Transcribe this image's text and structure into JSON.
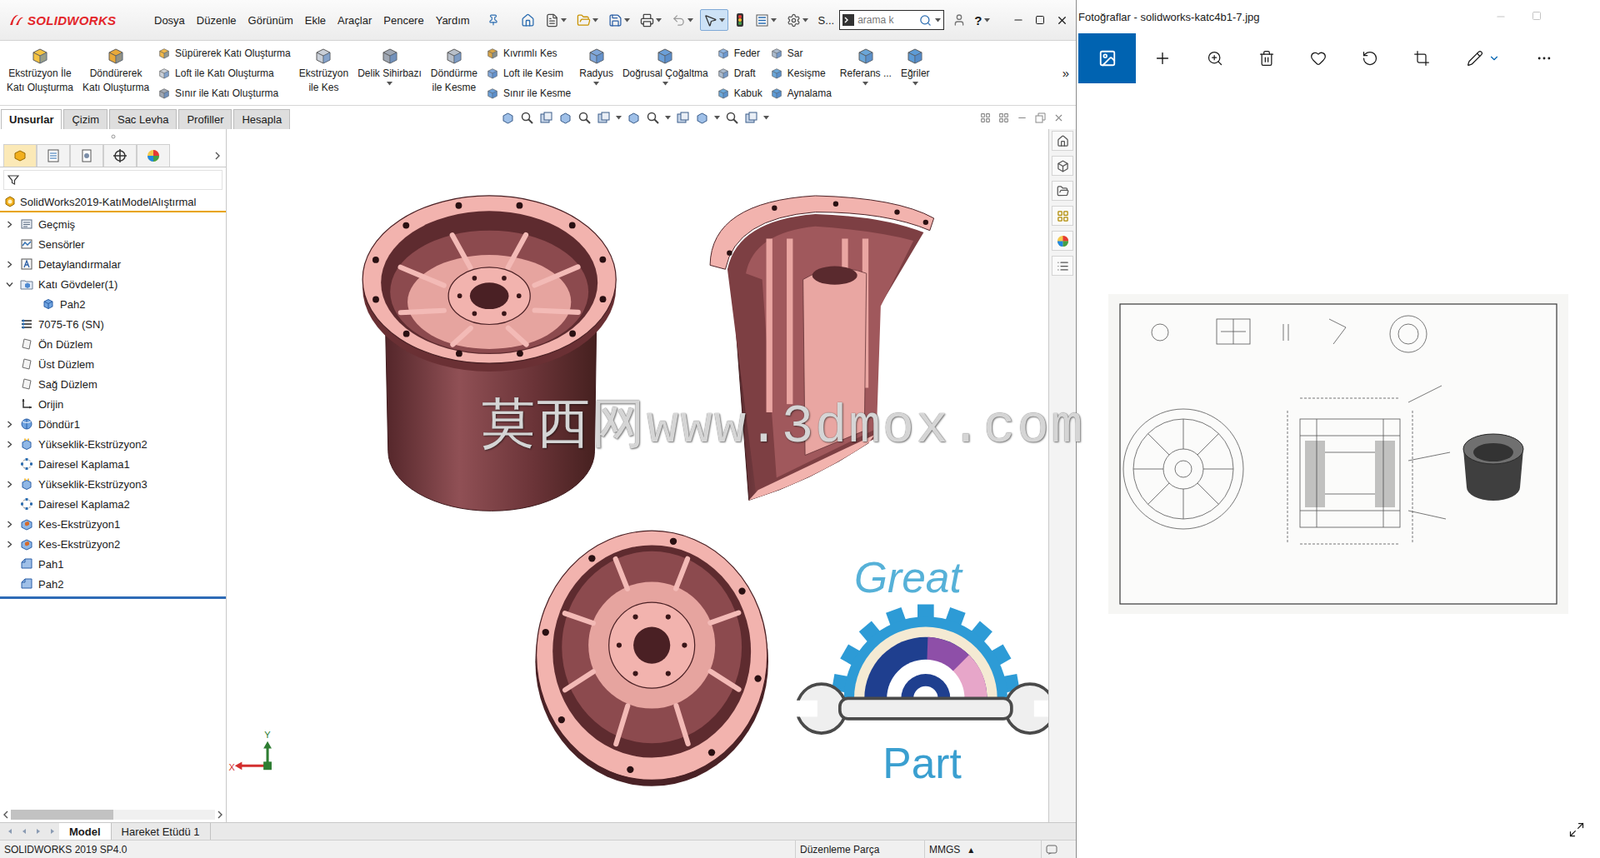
{
  "sw": {
    "logo": "SOLIDWORKS",
    "menus": [
      "Dosya",
      "Düzenle",
      "Görünüm",
      "Ekle",
      "Araçlar",
      "Pencere",
      "Yardım"
    ],
    "quick_tools": [
      {
        "kind": "home",
        "dropdown": false,
        "active": false
      },
      {
        "kind": "new",
        "dropdown": true,
        "active": false
      },
      {
        "kind": "open",
        "dropdown": true,
        "active": false
      },
      {
        "kind": "save",
        "dropdown": true,
        "active": false
      },
      {
        "kind": "print",
        "dropdown": true,
        "active": false
      },
      {
        "kind": "undo",
        "dropdown": true,
        "active": false
      },
      {
        "kind": "select",
        "dropdown": true,
        "active": true
      },
      {
        "kind": "rebuild",
        "dropdown": false,
        "active": false
      },
      {
        "kind": "options",
        "dropdown": true,
        "active": false
      },
      {
        "kind": "settings",
        "dropdown": true,
        "active": false
      }
    ],
    "command_label": "S...",
    "search": {
      "placeholder": "arama k"
    },
    "help": "?",
    "ribbon": [
      {
        "kind": "large",
        "lines": [
          "Ekstrüzyon İle",
          "Katı Oluşturma"
        ],
        "dropdown": false
      },
      {
        "kind": "large",
        "lines": [
          "Döndürerek",
          "Katı Oluşturma"
        ],
        "dropdown": false
      },
      {
        "kind": "stack",
        "rows": [
          "Süpürerek Katı Oluşturma",
          "Loft ile Katı Oluşturma",
          "Sınır ile Katı Oluşturma"
        ]
      },
      {
        "kind": "large",
        "lines": [
          "Ekstrüzyon",
          "ile Kes"
        ],
        "dropdown": false
      },
      {
        "kind": "large",
        "lines": [
          "Delik Sihirbazı"
        ],
        "dropdown": true
      },
      {
        "kind": "large",
        "lines": [
          "Döndürme",
          "ile Kesme"
        ],
        "dropdown": false
      },
      {
        "kind": "stack",
        "rows": [
          "Kıvrımlı Kes",
          "Loft ile Kesim",
          "Sınır ile Kesme"
        ]
      },
      {
        "kind": "large",
        "lines": [
          "Radyus"
        ],
        "dropdown": true
      },
      {
        "kind": "large",
        "lines": [
          "Doğrusal Çoğaltma"
        ],
        "dropdown": true
      },
      {
        "kind": "stack",
        "rows": [
          "Feder",
          "Draft",
          "Kabuk"
        ]
      },
      {
        "kind": "stack",
        "rows": [
          "Sar",
          "Kesişme",
          "Aynalama"
        ]
      },
      {
        "kind": "large",
        "lines": [
          "Referans ..."
        ],
        "dropdown": true
      },
      {
        "kind": "large",
        "lines": [
          "Eğriler"
        ],
        "dropdown": true
      }
    ],
    "ribbon_more": "»",
    "tabs": [
      {
        "label": "Unsurlar",
        "selected": true
      },
      {
        "label": "Çizim",
        "selected": false
      },
      {
        "label": "Sac Levha",
        "selected": false
      },
      {
        "label": "Profiller",
        "selected": false
      },
      {
        "label": "Hesapla",
        "selected": false
      }
    ],
    "panel_tabs": [
      {
        "kind": "feature-manager",
        "selected": true
      },
      {
        "kind": "property-manager",
        "selected": false
      },
      {
        "kind": "configuration-manager",
        "selected": false
      },
      {
        "kind": "dimxpert",
        "selected": false
      },
      {
        "kind": "display-manager",
        "selected": false
      }
    ],
    "tree": {
      "root": "SolidWorks2019-KatıModelAlıştırmal",
      "items": [
        {
          "label": "Geçmiş",
          "kind": "history",
          "depth": 0,
          "expandable": true,
          "expanded": false
        },
        {
          "label": "Sensörler",
          "kind": "sensor",
          "depth": 0,
          "expandable": false,
          "expanded": false
        },
        {
          "label": "Detaylandırmalar",
          "kind": "annotations",
          "depth": 0,
          "expandable": true,
          "expanded": false
        },
        {
          "label": "Katı Gövdeler(1)",
          "kind": "bodies",
          "depth": 0,
          "expandable": true,
          "expanded": true
        },
        {
          "label": "Pah2",
          "kind": "body",
          "depth": 1,
          "expandable": false,
          "expanded": false
        },
        {
          "label": "7075-T6 (SN)",
          "kind": "material",
          "depth": 0,
          "expandable": false,
          "expanded": false
        },
        {
          "label": "Ön Düzlem",
          "kind": "plane",
          "depth": 0,
          "expandable": false,
          "expanded": false
        },
        {
          "label": "Üst Düzlem",
          "kind": "plane",
          "depth": 0,
          "expandable": false,
          "expanded": false
        },
        {
          "label": "Sağ Düzlem",
          "kind": "plane",
          "depth": 0,
          "expandable": false,
          "expanded": false
        },
        {
          "label": "Orijin",
          "kind": "origin",
          "depth": 0,
          "expandable": false,
          "expanded": false
        },
        {
          "label": "Döndür1",
          "kind": "revolve",
          "depth": 0,
          "expandable": true,
          "expanded": false
        },
        {
          "label": "Yükseklik-Ekstrüzyon2",
          "kind": "boss",
          "depth": 0,
          "expandable": true,
          "expanded": false
        },
        {
          "label": "Dairesel Kaplama1",
          "kind": "pattern",
          "depth": 0,
          "expandable": false,
          "expanded": false
        },
        {
          "label": "Yükseklik-Ekstrüzyon3",
          "kind": "boss",
          "depth": 0,
          "expandable": true,
          "expanded": false
        },
        {
          "label": "Dairesel Kaplama2",
          "kind": "pattern",
          "depth": 0,
          "expandable": false,
          "expanded": false
        },
        {
          "label": "Kes-Ekstrüzyon1",
          "kind": "cut",
          "depth": 0,
          "expandable": true,
          "expanded": false
        },
        {
          "label": "Kes-Ekstrüzyon2",
          "kind": "cut",
          "depth": 0,
          "expandable": true,
          "expanded": false
        },
        {
          "label": "Pah1",
          "kind": "chamfer",
          "depth": 0,
          "expandable": false,
          "expanded": false
        },
        {
          "label": "Pah2",
          "kind": "chamfer",
          "depth": 0,
          "expandable": false,
          "expanded": false
        }
      ],
      "scroll": {
        "level": 0.5
      }
    },
    "triad": {
      "x": "X",
      "y": "Y"
    },
    "brand": {
      "top": "Great",
      "bottom": "Part"
    },
    "bottom_tabs": [
      {
        "label": "Model",
        "selected": true
      },
      {
        "label": "Hareket Etüdü 1",
        "selected": false
      }
    ],
    "status": {
      "version": "SOLIDWORKS 2019 SP4.0",
      "mode": "Düzenleme Parça",
      "units": "MMGS",
      "units_arrow": "▴"
    }
  },
  "photos": {
    "title": "Fotoğraflar - solidworks-katc4b1-7.jpg"
  },
  "watermark": "莫西网www.3dmox.com"
}
